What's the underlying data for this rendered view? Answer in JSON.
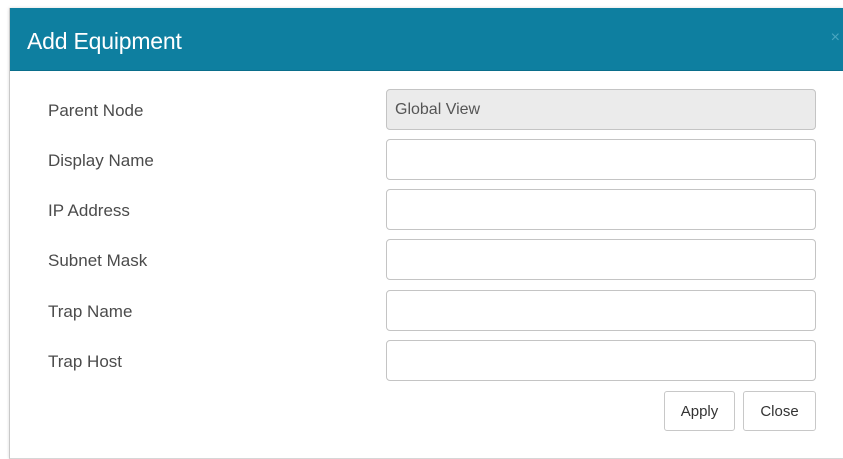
{
  "dialog": {
    "title": "Add Equipment",
    "close_glyph": "×"
  },
  "fields": [
    {
      "label": "Parent Node",
      "value": "Global View",
      "placeholder": "",
      "readonly": true
    },
    {
      "label": "Display Name",
      "value": "",
      "placeholder": "",
      "readonly": false
    },
    {
      "label": "IP Address",
      "value": "",
      "placeholder": "",
      "readonly": false
    },
    {
      "label": "Subnet Mask",
      "value": "",
      "placeholder": "",
      "readonly": false
    },
    {
      "label": "Trap Name",
      "value": "",
      "placeholder": "",
      "readonly": false
    },
    {
      "label": "Trap Host",
      "value": "",
      "placeholder": "",
      "readonly": false
    }
  ],
  "buttons": {
    "apply_label": "Apply",
    "close_label": "Close"
  },
  "colors": {
    "header_bg": "#0e7fa0",
    "header_text": "#ffffff",
    "readonly_bg": "#ebebeb"
  }
}
